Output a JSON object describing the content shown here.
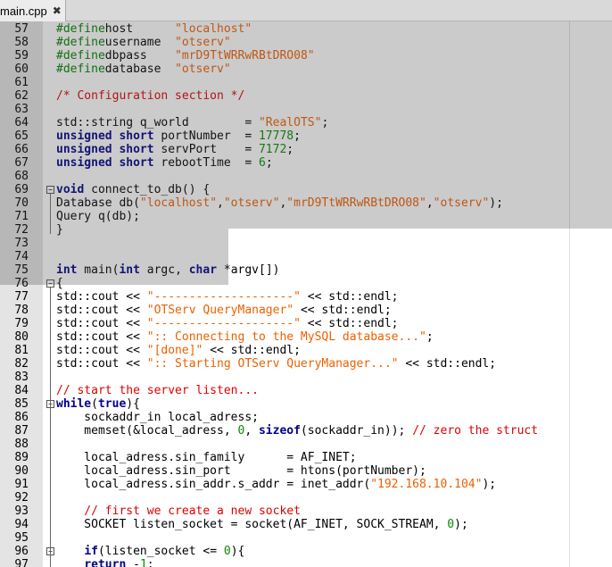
{
  "tab": {
    "label": "main.cpp",
    "close_symbol": "✖"
  },
  "lines": [
    {
      "n": "57",
      "t": [
        [
          "pp",
          "#define"
        ],
        [
          "",
          "host      "
        ],
        [
          "str",
          "\"localhost\""
        ]
      ]
    },
    {
      "n": "58",
      "t": [
        [
          "pp",
          "#define"
        ],
        [
          "",
          "username  "
        ],
        [
          "str",
          "\"otserv\""
        ]
      ]
    },
    {
      "n": "59",
      "t": [
        [
          "pp",
          "#define"
        ],
        [
          "",
          "dbpass    "
        ],
        [
          "str",
          "\"mrD9TtWRRwRBtDRO08\""
        ]
      ]
    },
    {
      "n": "60",
      "t": [
        [
          "pp",
          "#define"
        ],
        [
          "",
          "database  "
        ],
        [
          "str",
          "\"otserv\""
        ]
      ]
    },
    {
      "n": "61",
      "t": []
    },
    {
      "n": "62",
      "t": [
        [
          "cm",
          "/* Configuration section */"
        ]
      ]
    },
    {
      "n": "63",
      "t": []
    },
    {
      "n": "64",
      "t": [
        [
          "",
          "std::string q_world        = "
        ],
        [
          "str",
          "\"RealOTS\""
        ],
        [
          "",
          ";"
        ]
      ]
    },
    {
      "n": "65",
      "t": [
        [
          "kw",
          "unsigned short"
        ],
        [
          "",
          " portNumber  = "
        ],
        [
          "num",
          "17778"
        ],
        [
          "",
          ";"
        ]
      ]
    },
    {
      "n": "66",
      "t": [
        [
          "kw",
          "unsigned short"
        ],
        [
          "",
          " servPort    = "
        ],
        [
          "num",
          "7172"
        ],
        [
          "",
          ";"
        ]
      ]
    },
    {
      "n": "67",
      "t": [
        [
          "kw",
          "unsigned short"
        ],
        [
          "",
          " rebootTime  = "
        ],
        [
          "num",
          "6"
        ],
        [
          "",
          ";"
        ]
      ]
    },
    {
      "n": "68",
      "t": []
    },
    {
      "n": "69",
      "t": [
        [
          "kw",
          "void"
        ],
        [
          "",
          " connect_to_db() {"
        ]
      ]
    },
    {
      "n": "70",
      "t": [
        [
          "",
          "Database db("
        ],
        [
          "str",
          "\"localhost\""
        ],
        [
          "",
          ","
        ],
        [
          "str",
          "\"otserv\""
        ],
        [
          "",
          ","
        ],
        [
          "str",
          "\"mrD9TtWRRwRBtDRO08\""
        ],
        [
          "",
          ","
        ],
        [
          "str",
          "\"otserv\""
        ],
        [
          "",
          ");"
        ]
      ]
    },
    {
      "n": "71",
      "t": [
        [
          "",
          "Query q(db);"
        ]
      ]
    },
    {
      "n": "72",
      "t": [
        [
          "",
          "}"
        ]
      ]
    },
    {
      "n": "73",
      "t": []
    },
    {
      "n": "74",
      "t": []
    },
    {
      "n": "75",
      "t": [
        [
          "kw",
          "int"
        ],
        [
          "",
          " main("
        ],
        [
          "kw",
          "int"
        ],
        [
          "",
          " argc, "
        ],
        [
          "kw",
          "char"
        ],
        [
          "",
          " *argv[])"
        ]
      ]
    },
    {
      "n": "76",
      "t": [
        [
          "",
          "{"
        ]
      ]
    },
    {
      "n": "77",
      "t": [
        [
          "",
          "std::cout << "
        ],
        [
          "str",
          "\"--------------------\""
        ],
        [
          "",
          " << std::endl;"
        ]
      ]
    },
    {
      "n": "78",
      "t": [
        [
          "",
          "std::cout << "
        ],
        [
          "str",
          "\"OTServ QueryManager\""
        ],
        [
          "",
          " << std::endl;"
        ]
      ]
    },
    {
      "n": "79",
      "t": [
        [
          "",
          "std::cout << "
        ],
        [
          "str",
          "\"--------------------\""
        ],
        [
          "",
          " << std::endl;"
        ]
      ]
    },
    {
      "n": "80",
      "t": [
        [
          "",
          "std::cout << "
        ],
        [
          "str",
          "\":: Connecting to the MySQL database...\""
        ],
        [
          "",
          ";"
        ]
      ]
    },
    {
      "n": "81",
      "t": [
        [
          "",
          "std::cout << "
        ],
        [
          "str",
          "\"[done]\""
        ],
        [
          "",
          " << std::endl;"
        ]
      ]
    },
    {
      "n": "82",
      "t": [
        [
          "",
          "std::cout << "
        ],
        [
          "str",
          "\":: Starting OTServ QueryManager...\""
        ],
        [
          "",
          " << std::endl;"
        ]
      ]
    },
    {
      "n": "83",
      "t": []
    },
    {
      "n": "84",
      "t": [
        [
          "cm",
          "// start the server listen..."
        ]
      ]
    },
    {
      "n": "85",
      "t": [
        [
          "kw",
          "while"
        ],
        [
          "",
          "("
        ],
        [
          "kw",
          "true"
        ],
        [
          "",
          "){"
        ]
      ]
    },
    {
      "n": "86",
      "t": [
        [
          "",
          "    sockaddr_in local_adress;"
        ]
      ]
    },
    {
      "n": "87",
      "t": [
        [
          "",
          "    memset(&local_adress, "
        ],
        [
          "num",
          "0"
        ],
        [
          "",
          ", "
        ],
        [
          "kw",
          "sizeof"
        ],
        [
          "",
          "(sockaddr_in)); "
        ],
        [
          "cm",
          "// zero the struct"
        ]
      ]
    },
    {
      "n": "88",
      "t": []
    },
    {
      "n": "89",
      "t": [
        [
          "",
          "    local_adress.sin_family      = AF_INET;"
        ]
      ]
    },
    {
      "n": "90",
      "t": [
        [
          "",
          "    local_adress.sin_port        = htons(portNumber);"
        ]
      ]
    },
    {
      "n": "91",
      "t": [
        [
          "",
          "    local_adress.sin_addr.s_addr = inet_addr("
        ],
        [
          "str",
          "\"192.168.10.104\""
        ],
        [
          "",
          ");"
        ]
      ]
    },
    {
      "n": "92",
      "t": []
    },
    {
      "n": "93",
      "t": [
        [
          "cm",
          "    // first we create a new socket"
        ]
      ]
    },
    {
      "n": "94",
      "t": [
        [
          "",
          "    SOCKET listen_socket = socket(AF_INET, SOCK_STREAM, "
        ],
        [
          "num",
          "0"
        ],
        [
          "",
          ");"
        ]
      ]
    },
    {
      "n": "95",
      "t": []
    },
    {
      "n": "96",
      "t": [
        [
          "",
          "    "
        ],
        [
          "kw",
          "if"
        ],
        [
          "",
          "(listen_socket <= "
        ],
        [
          "num",
          "0"
        ],
        [
          "",
          "){"
        ]
      ]
    },
    {
      "n": "97",
      "t": [
        [
          "",
          "    "
        ],
        [
          "kw",
          "return"
        ],
        [
          "",
          " -"
        ],
        [
          "num",
          "1"
        ],
        [
          "",
          ";"
        ]
      ]
    }
  ],
  "folds": {
    "69": "⊟",
    "76": "⊟",
    "85": "⊟",
    "96": "⊟"
  }
}
